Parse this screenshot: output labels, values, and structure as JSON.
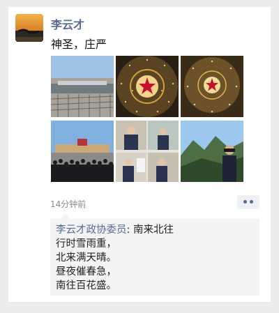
{
  "post": {
    "author": "李云才",
    "text": "神圣，庄严",
    "time": "14分钟前",
    "photos": [
      {
        "name": "photo-highway"
      },
      {
        "name": "photo-ceiling-star"
      },
      {
        "name": "photo-ceiling-star-2"
      },
      {
        "name": "photo-crowd-square"
      },
      {
        "name": "photo-meeting-collage"
      },
      {
        "name": "photo-mountain-portrait"
      }
    ]
  },
  "comment": {
    "author": "李云才政协委员",
    "separator": ": ",
    "first_line": "南来北往",
    "lines": [
      "行时雪雨重，",
      "北来满天晴。",
      "昼夜催春急，",
      "南往百花盛。"
    ]
  },
  "colors": {
    "link": "#576b95",
    "star": "#c8102e",
    "gold": "#d4a23a"
  }
}
